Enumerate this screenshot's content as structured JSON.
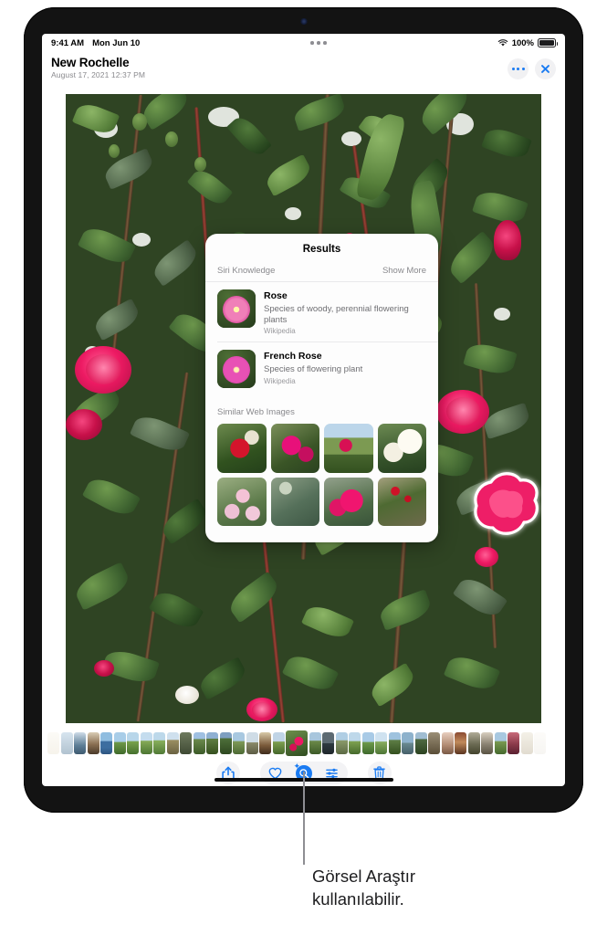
{
  "statusbar": {
    "time": "9:41 AM",
    "date": "Mon Jun 10",
    "wifi_icon": "wifi-icon",
    "battery_percent": "100%",
    "battery_icon": "battery-icon",
    "multitask_icon": "multitasking-dots-icon"
  },
  "navbar": {
    "title": "New Rochelle",
    "subtitle": "August 17, 2021  12:37 PM",
    "more_icon": "more-dots-icon",
    "close_icon": "close-x-icon",
    "accent_color": "#1a7bf2",
    "button_bg": "#f1f1f3"
  },
  "popover": {
    "title": "Results",
    "siri_section": {
      "label": "Siri Knowledge",
      "show_more_label": "Show More"
    },
    "results": [
      {
        "name": "Rose",
        "description": "Species of woody, perennial flowering plants",
        "source": "Wikipedia",
        "thumb_icon": "rose-thumbnail"
      },
      {
        "name": "French Rose",
        "description": "Species of flowering plant",
        "source": "Wikipedia",
        "thumb_icon": "french-rose-thumbnail"
      }
    ],
    "web_section": {
      "label": "Similar Web Images",
      "thumbnails": [
        "red-rose-bush-image",
        "magenta-rose-cluster-image",
        "rose-garden-skyline-image",
        "white-roses-image",
        "pale-pink-roses-image",
        "rose-foliage-image",
        "pink-rose-buds-image",
        "red-rose-shrub-with-label-image"
      ]
    }
  },
  "photo": {
    "subject_label": "highlighted-rose-subject",
    "description": "rose-bush-photo"
  },
  "toolbar": {
    "share_icon": "share-icon",
    "favorite_icon": "heart-icon",
    "visual_lookup_icon": "visual-look-up-icon",
    "adjust_icon": "adjustments-sliders-icon",
    "delete_icon": "trash-icon",
    "accent_color": "#1a7bf2",
    "pill_bg": "#f3f3f5"
  },
  "filmstrip": {
    "label": "photo-filmstrip",
    "current_index": 16
  },
  "callout": {
    "text": "Görsel Araştır\nkullanılabilir.",
    "line_color": "#8e8e93"
  }
}
